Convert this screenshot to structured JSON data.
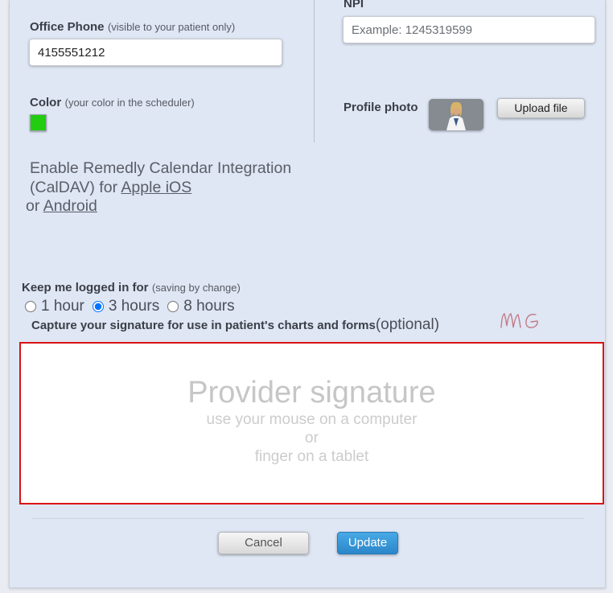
{
  "npi": {
    "label": "NPI",
    "placeholder": "Example: 1245319599"
  },
  "office_phone": {
    "label": "Office Phone",
    "note": "(visible to your patient only)",
    "value": "4155551212"
  },
  "color": {
    "label": "Color",
    "note": "(your color in the scheduler)",
    "value": "#22cc11"
  },
  "profile_photo": {
    "label": "Profile photo",
    "upload_label": "Upload file"
  },
  "caldav": {
    "text_before": "Enable Remedly Calendar Integration (CalDAV) for ",
    "link_ios": "Apple iOS",
    "text_or": " or ",
    "link_android": "Android"
  },
  "keep_logged": {
    "label": "Keep me logged in for",
    "note": "(saving by change)",
    "options": [
      "1 hour",
      "3 hours",
      "8 hours"
    ],
    "selected": "3 hours"
  },
  "signature": {
    "caption": "Capture your signature for use in patient's charts and forms",
    "caption_optional": "(optional)",
    "existing_initials": "MG",
    "placeholder_title": "Provider signature",
    "placeholder_line1": "use your mouse on a computer",
    "placeholder_line2": "or",
    "placeholder_line3": "finger on a tablet"
  },
  "actions": {
    "cancel_label": "Cancel",
    "update_label": "Update"
  }
}
